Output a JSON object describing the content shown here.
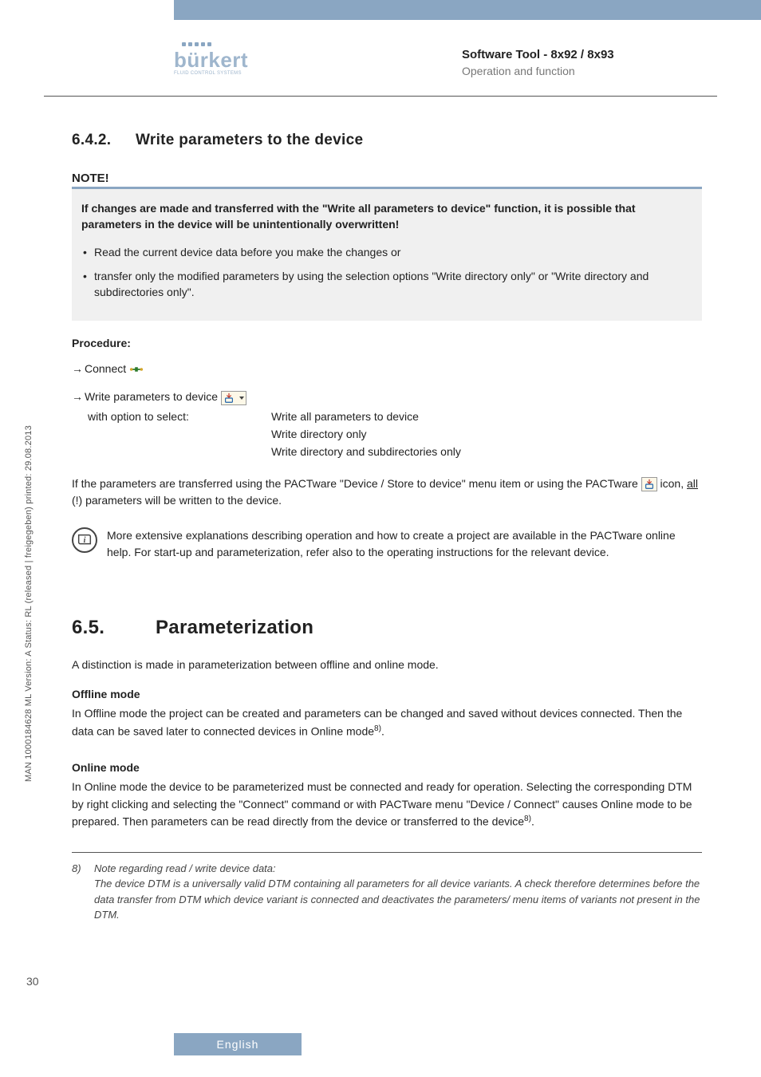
{
  "header": {
    "logo_text": "bürkert",
    "logo_sub": "FLUID CONTROL SYSTEMS",
    "doc_title": "Software Tool - 8x92 / 8x93",
    "doc_subtitle": "Operation and function"
  },
  "section_642": {
    "number": "6.4.2.",
    "title": "Write parameters to the device",
    "note_label": "NOTE!",
    "note_lead_pre": "If changes are made and transferred with the \"",
    "note_lead_bold": "Write all parameters to device",
    "note_lead_post": "\" function, it is possible that parameters in the device will be unintentionally overwritten!",
    "bullet1": "Read the current device data before you make the changes or",
    "bullet2": "transfer only the modified parameters by using the selection options \"Write directory only\" or \"Write directory and subdirectories only\".",
    "procedure_label": "Procedure:",
    "step1": "Connect",
    "step2": "Write parameters to device",
    "step2_sub_label": "with option to select:",
    "step2_opt1": "Write all parameters to device",
    "step2_opt2": "Write directory only",
    "step2_opt3": "Write directory and subdirectories only",
    "after_para_pre": "If the parameters are transferred using the PACTware \"Device / Store to device\" menu item or using the PACTware ",
    "after_para_mid1": " icon, ",
    "after_para_all": "all",
    "after_para_post": " (!) parameters will be written to the device.",
    "info_text": "More extensive explanations describing operation and how to create a project are available in the PACTware online help. For start-up and parameterization, refer also to the operating instructions for the relevant device."
  },
  "section_65": {
    "number": "6.5.",
    "title": "Parameterization",
    "distinction": "A distinction is made in parameterization between offline and online mode.",
    "offline_h": "Offline mode",
    "offline_p_pre": "In Offline mode the project can be created and parameters can be changed and saved without devices connected. Then the data can be saved later to connected devices in Online mode",
    "offline_sup": "8)",
    "offline_p_post": ".",
    "online_h": "Online mode",
    "online_p_pre": "In Online mode the device to be parameterized must be connected and ready for operation. Selecting the corresponding DTM by right clicking and selecting the \"Connect\" command or with PACTware menu \"Device / Connect\" causes Online mode to be prepared. Then parameters can be read directly from the device or transferred to the device",
    "online_sup": "8)",
    "online_p_post": "."
  },
  "footnote": {
    "num": "8)",
    "line1": "Note regarding read / write device data:",
    "line2": "The device DTM is a universally valid DTM containing all parameters for all device variants. A check therefore determines before the data transfer from DTM which device variant is connected and deactivates the parameters/ menu items of variants not present in the DTM."
  },
  "side_text": "MAN 1000184628 ML Version: A Status: RL (released | freigegeben) printed: 29.08.2013",
  "page_number": "30",
  "footer_lang": "English"
}
